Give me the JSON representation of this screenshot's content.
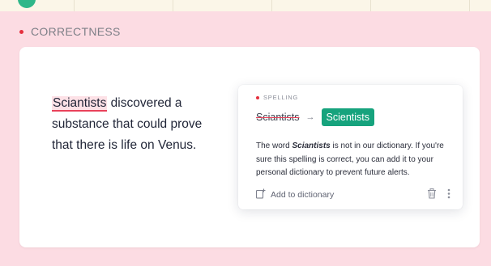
{
  "section": {
    "label": "CORRECTNESS"
  },
  "example": {
    "misspelled_word": "Sciantists",
    "rest_line1": " discovered a",
    "line2": "substance that could prove",
    "line3": "that there is life on Venus."
  },
  "popup": {
    "category": "SPELLING",
    "wrong_word": "Sciantists",
    "arrow": "→",
    "suggestion": "Scientists",
    "explanation_prefix": "The word ",
    "explanation_word": "Sciantists",
    "explanation_suffix": " is not in our dictionary. If you're sure this spelling is correct, you can add it to your personal dictionary to prevent future alerts.",
    "add_to_dictionary": "Add to dictionary"
  },
  "colors": {
    "background": "#fcdce3",
    "error_red": "#e9425a",
    "accent_green": "#16a37d"
  },
  "icons": [
    "add-to-dictionary-icon",
    "trash-icon",
    "more-options-icon"
  ]
}
